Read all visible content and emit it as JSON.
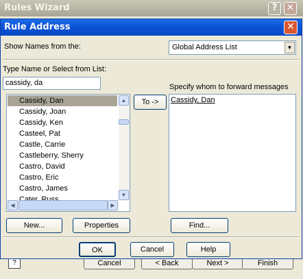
{
  "background_window": {
    "title": "Rules Wizard",
    "help_glyph": "?",
    "close_glyph": "✕",
    "buttons": {
      "cancel": "Cancel",
      "back": "< Back",
      "next": "Next >",
      "finish": "Finish"
    }
  },
  "dialog": {
    "title": "Rule Address",
    "close_glyph": "✕",
    "show_names_label": "Show Names from the:",
    "address_list_value": "Global Address List",
    "type_name_label": "Type Name or Select from List:",
    "search_value": "cassidy, da",
    "names": [
      "Cassidy, Dan",
      "Cassidy, Joan",
      "Cassidy, Ken",
      "Casteel, Pat",
      "Castle, Carrie",
      "Castleberry, Sherry",
      "Castro, David",
      "Castro, Eric",
      "Castro, James",
      "Cater, Russ"
    ],
    "selected_index": 0,
    "to_button": "To ->",
    "forward_label": "Specify whom to forward messages",
    "forward_recipients": [
      "Cassidy, Dan"
    ],
    "buttons": {
      "new": "New...",
      "properties": "Properties",
      "find": "Find...",
      "ok": "OK",
      "cancel": "Cancel",
      "help": "Help"
    }
  },
  "icons": {
    "dropdown": "chevron-down-icon",
    "scroll_up": "chevron-up-icon",
    "scroll_down": "chevron-down-icon",
    "scroll_left": "chevron-left-icon",
    "scroll_right": "chevron-right-icon"
  }
}
